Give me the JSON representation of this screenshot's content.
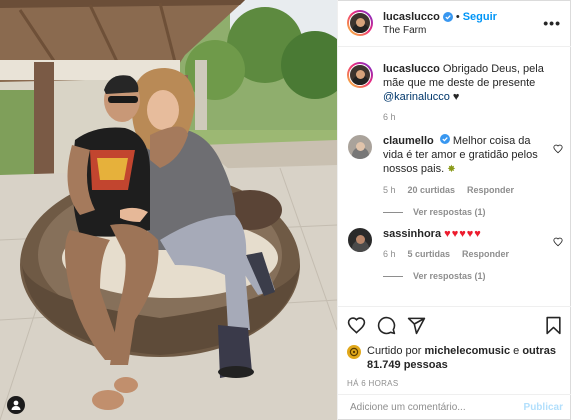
{
  "post": {
    "username": "lucaslucco",
    "follow_label": "Seguir",
    "location": "The Farm",
    "more_label": "•••"
  },
  "caption": {
    "username": "lucaslucco",
    "text": "Obrigado Deus, pela mãe que me deste de presente",
    "mention": "@karinalucco",
    "heart": "♥",
    "age": "6 h"
  },
  "comments": [
    {
      "username": "claumello",
      "text": "Melhor coisa da vida é ter amor e gratidão pelos nossos pais.",
      "emoji": "✸",
      "age": "5 h",
      "likes": "20 curtidas",
      "reply_label": "Responder",
      "view_replies": "Ver respostas (1)"
    },
    {
      "username": "sassinhora",
      "text": "",
      "emoji": "♥♥♥♥♥",
      "age": "6 h",
      "likes": "5 curtidas",
      "reply_label": "Responder",
      "view_replies": "Ver respostas (1)"
    }
  ],
  "likes": {
    "prefix": "Curtido por",
    "user": "michelecomusic",
    "connector": "e",
    "others": "outras 81.749 pessoas"
  },
  "timestamp": "HÁ 6 HORAS",
  "add_comment": {
    "placeholder": "Adicione um comentário...",
    "publish_label": "Publicar"
  },
  "icons": [
    "heart-icon",
    "comment-icon",
    "share-icon",
    "bookmark-icon",
    "verified-icon",
    "more-icon",
    "instagram-avatar-icon"
  ],
  "colors": {
    "accent": "#0095f6",
    "mention": "#00376b",
    "muted": "#8e8e8e",
    "heart_red": "#ed1c2e",
    "publish_disabled": "#b2dffc"
  }
}
